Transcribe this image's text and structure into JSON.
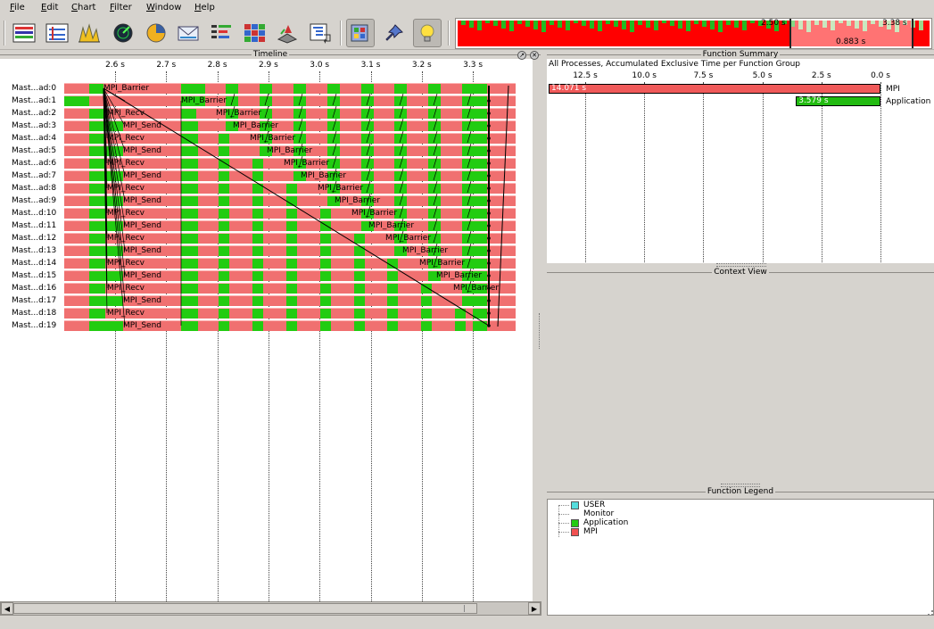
{
  "menubar": {
    "items": [
      {
        "label": "File"
      },
      {
        "label": "Edit"
      },
      {
        "label": "Chart"
      },
      {
        "label": "Filter"
      },
      {
        "label": "Window"
      },
      {
        "label": "Help"
      }
    ]
  },
  "toolbar": {
    "buttons": [
      {
        "icon": "master-timeline-icon"
      },
      {
        "icon": "process-timeline-icon"
      },
      {
        "icon": "counter-data-icon"
      },
      {
        "icon": "performance-radar-icon"
      },
      {
        "icon": "function-summary-pie-icon"
      },
      {
        "icon": "message-summary-icon"
      },
      {
        "icon": "process-summary-icon"
      },
      {
        "icon": "communication-matrix-icon"
      },
      {
        "icon": "io-activity-icon"
      },
      {
        "icon": "call-tree-icon"
      },
      {
        "icon": "grouping-filter-icon"
      },
      {
        "icon": "pin-icon"
      },
      {
        "icon": "lightbulb-icon"
      }
    ],
    "active": [
      "grouping-filter-icon",
      "lightbulb-icon"
    ]
  },
  "overview": {
    "start_label": "2.50 s",
    "end_label": "3.38 s",
    "duration_label": "0.883 s"
  },
  "timeline": {
    "title": "Timeline",
    "ticks": [
      "2.6 s",
      "2.7 s",
      "2.8 s",
      "2.9 s",
      "3.0 s",
      "3.1 s",
      "3.2 s",
      "3.3 s"
    ],
    "processes": [
      {
        "label": "Mast...ad:0",
        "fn": "MPI_Barrier"
      },
      {
        "label": "Mast...ad:1",
        "fn": "MPI_Barrier"
      },
      {
        "label": "Mast...ad:2",
        "fn": "MPI_Recv",
        "fn2": "MPI_Barrier"
      },
      {
        "label": "Mast...ad:3",
        "fn": "MPI_Send",
        "fn2": "MPI_Barrier"
      },
      {
        "label": "Mast...ad:4",
        "fn": "MPI_Recv",
        "fn2": "MPI_Barrier"
      },
      {
        "label": "Mast...ad:5",
        "fn": "MPI_Send",
        "fn2": "MPI_Barrier"
      },
      {
        "label": "Mast...ad:6",
        "fn": "MPI_Recv",
        "fn2": "MPI_Barrier"
      },
      {
        "label": "Mast...ad:7",
        "fn": "MPI_Send",
        "fn2": "MPI_Barrier"
      },
      {
        "label": "Mast...ad:8",
        "fn": "MPI_Recv",
        "fn2": "MPI_Barrier"
      },
      {
        "label": "Mast...ad:9",
        "fn": "MPI_Send",
        "fn2": "MPI_Barrier"
      },
      {
        "label": "Mast...d:10",
        "fn": "MPI_Recv",
        "fn2": "MPI_Barrier"
      },
      {
        "label": "Mast...d:11",
        "fn": "MPI_Send",
        "fn2": "MPI_Barrier"
      },
      {
        "label": "Mast...d:12",
        "fn": "MPI_Recv",
        "fn2": "MPI_Barrier"
      },
      {
        "label": "Mast...d:13",
        "fn": "MPI_Send",
        "fn2": "MPI_Barrier"
      },
      {
        "label": "Mast...d:14",
        "fn": "MPI_Recv",
        "fn2": "MPI_Barrier"
      },
      {
        "label": "Mast...d:15",
        "fn": "MPI_Send",
        "fn2": "MPI_Barrier"
      },
      {
        "label": "Mast...d:16",
        "fn": "MPI_Recv",
        "fn2": "MPI_Barrier"
      },
      {
        "label": "Mast...d:17",
        "fn": "MPI_Send"
      },
      {
        "label": "Mast...d:18",
        "fn": "MPI_Recv"
      },
      {
        "label": "Mast...d:19",
        "fn": "MPI_Send"
      }
    ]
  },
  "function_summary": {
    "title": "Function Summary",
    "subtitle": "All Processes, Accumulated Exclusive Time per Function Group",
    "ticks": [
      "12.5 s",
      "10.0 s",
      "7.5 s",
      "5.0 s",
      "2.5 s",
      "0.0 s"
    ],
    "bars": [
      {
        "name": "MPI",
        "value_label": "14.071 s",
        "value": 14.071,
        "color": "#f05a5a"
      },
      {
        "name": "Application",
        "value_label": "3.579 s",
        "value": 3.579,
        "color": "#22bb11"
      }
    ]
  },
  "context_view": {
    "title": "Context View"
  },
  "function_legend": {
    "title": "Function Legend",
    "items": [
      {
        "label": "USER",
        "color": "#55dddd"
      },
      {
        "label": "Monitor",
        "color": "#ffffff"
      },
      {
        "label": "Application",
        "color": "#22cc11"
      },
      {
        "label": "MPI",
        "color": "#f05050"
      }
    ]
  }
}
